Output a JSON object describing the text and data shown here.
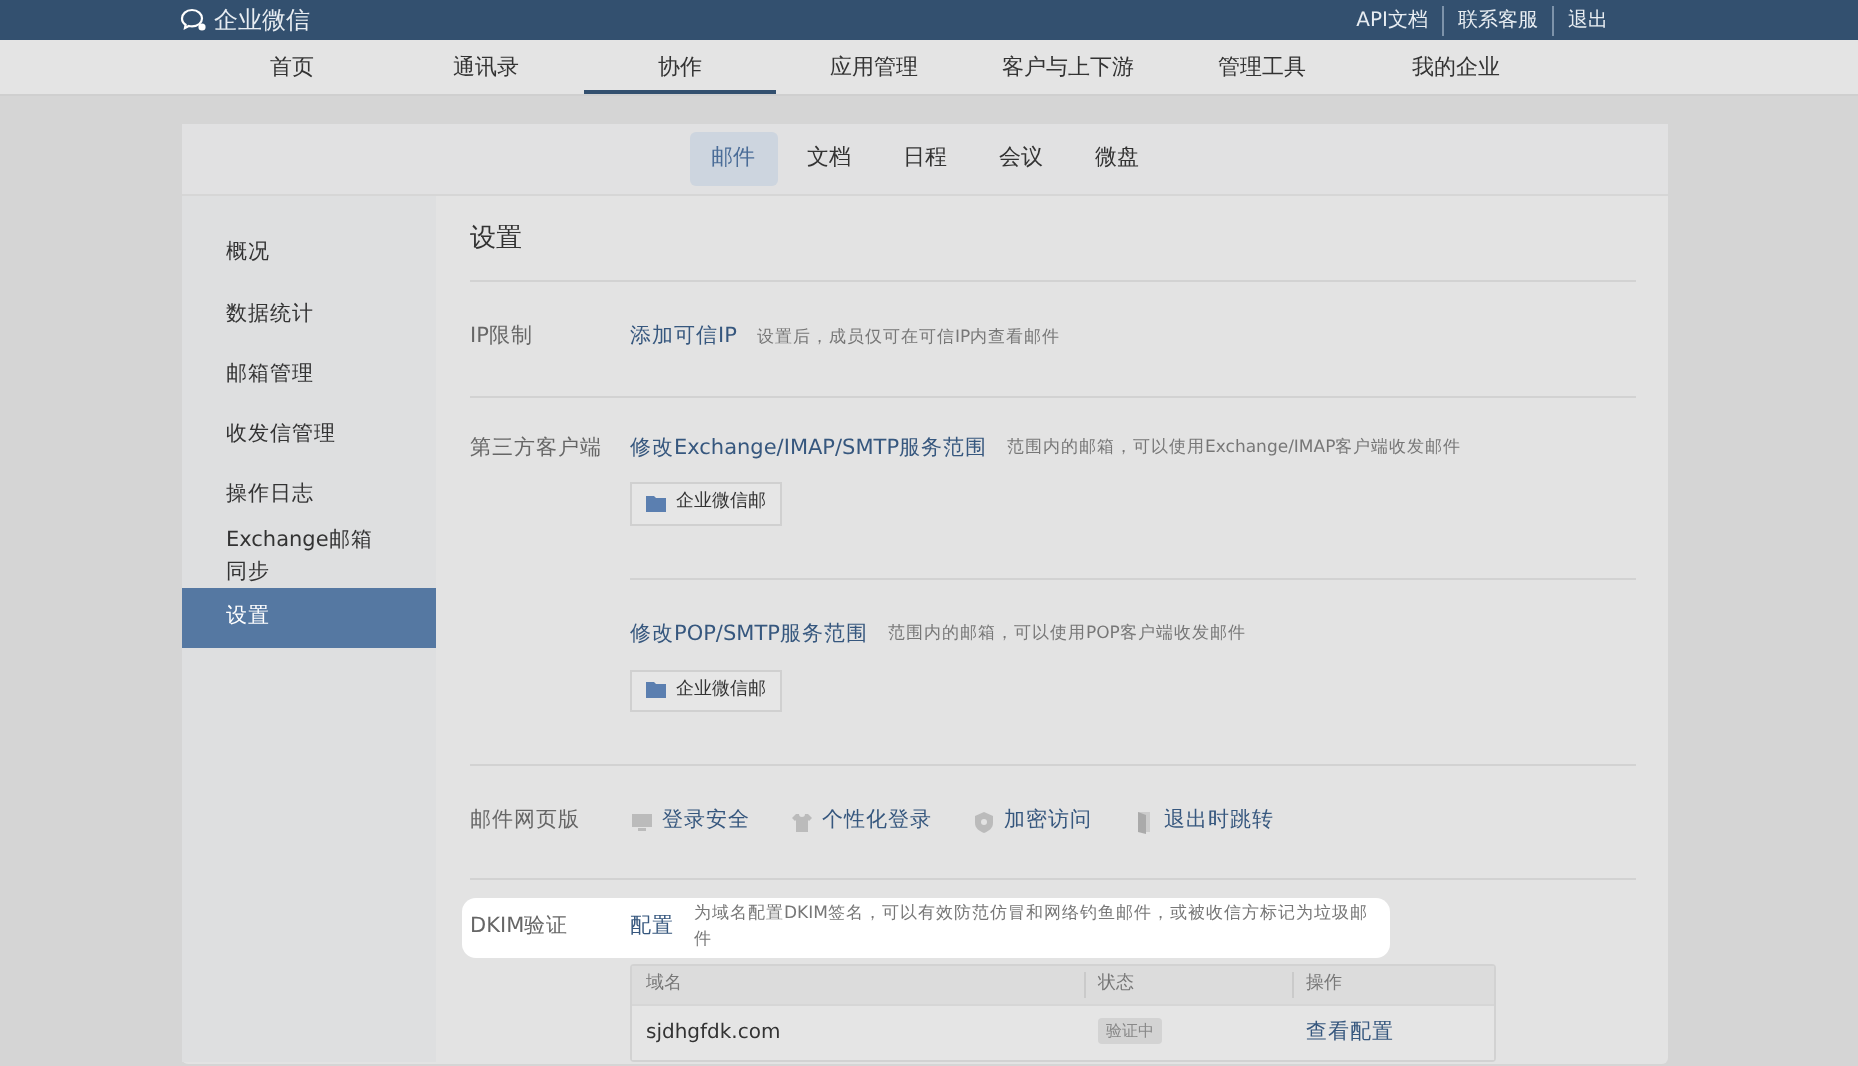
{
  "header": {
    "logo": "企业微信",
    "links": [
      "API文档",
      "联系客服",
      "退出"
    ]
  },
  "nav": [
    {
      "label": "首页",
      "selected": false
    },
    {
      "label": "通讯录",
      "selected": false
    },
    {
      "label": "协作",
      "selected": true
    },
    {
      "label": "应用管理",
      "selected": false
    },
    {
      "label": "客户与上下游",
      "selected": false
    },
    {
      "label": "管理工具",
      "selected": false
    },
    {
      "label": "我的企业",
      "selected": false
    }
  ],
  "subtabs": [
    {
      "label": "邮件",
      "selected": true
    },
    {
      "label": "文档",
      "selected": false
    },
    {
      "label": "日程",
      "selected": false
    },
    {
      "label": "会议",
      "selected": false
    },
    {
      "label": "微盘",
      "selected": false
    }
  ],
  "sidebar": [
    {
      "label": "概况",
      "selected": false
    },
    {
      "label": "数据统计",
      "selected": false
    },
    {
      "label": "邮箱管理",
      "selected": false
    },
    {
      "label": "收发信管理",
      "selected": false
    },
    {
      "label": "操作日志",
      "selected": false
    },
    {
      "label": "Exchange邮箱同步",
      "selected": false
    },
    {
      "label": "设置",
      "selected": true
    }
  ],
  "title": "设置",
  "ip": {
    "label": "IP限制",
    "link": "添加可信IP",
    "hint": "设置后，成员仅可在可信IP内查看邮件"
  },
  "client": {
    "label": "第三方客户端",
    "items": [
      {
        "link": "修改Exchange/IMAP/SMTP服务范围",
        "hint": "范围内的邮箱，可以使用Exchange/IMAP客户端收发邮件",
        "folder": "企业微信邮"
      },
      {
        "link": "修改POP/SMTP服务范围",
        "hint": "范围内的邮箱，可以使用POP客户端收发邮件",
        "folder": "企业微信邮"
      }
    ]
  },
  "web": {
    "label": "邮件网页版",
    "items": [
      {
        "kind": "monitor",
        "label": "登录安全"
      },
      {
        "kind": "shirt",
        "label": "个性化登录"
      },
      {
        "kind": "shield",
        "label": "加密访问"
      },
      {
        "kind": "door",
        "label": "退出时跳转"
      }
    ]
  },
  "dkim": {
    "label": "DKIM验证",
    "link": "配置",
    "hint": "为域名配置DKIM签名，可以有效防范仿冒和网络钓鱼邮件，或被收信方标记为垃圾邮件",
    "highlighted": true,
    "table": {
      "columns": [
        "域名",
        "状态",
        "操作"
      ],
      "rows": [
        {
          "domain": "sjdhgfdk.com",
          "status": "验证中",
          "action": "查看配置"
        }
      ]
    }
  }
}
